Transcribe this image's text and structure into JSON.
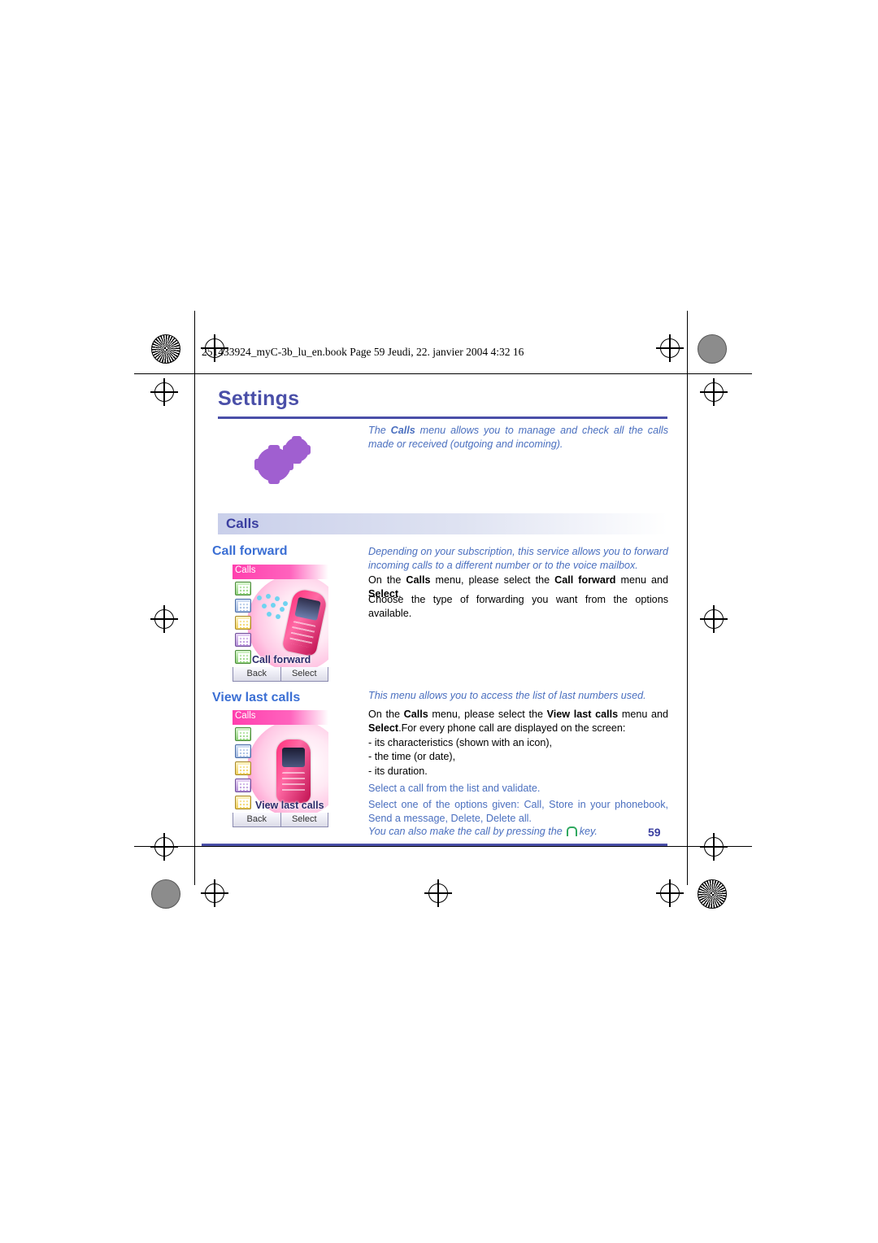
{
  "header": {
    "fileline": "251433924_myC-3b_lu_en.book  Page 59  Jeudi, 22. janvier 2004  4:32 16"
  },
  "chapter": {
    "title": "Settings",
    "intro_1": "The ",
    "intro_bold": "Calls",
    "intro_2": " menu allows you to manage and check all the calls made or received (outgoing and incoming)."
  },
  "section": {
    "label": "Calls"
  },
  "call_forward": {
    "heading": "Call forward",
    "para_italic": "Depending on your subscription, this service allows you to forward incoming calls to a different number or to the voice mailbox.",
    "para_2_a": "On the ",
    "para_2_b": "Calls",
    "para_2_c": " menu, please select the ",
    "para_2_d": "Call forward",
    "para_2_e": " menu and ",
    "para_2_f": "Select",
    "para_2_g": ".",
    "para_3": "Choose the type of forwarding you want from the options available.",
    "screenshot": {
      "title": "Calls",
      "label": "Call forward",
      "softkey_left": "Back",
      "softkey_right": "Select"
    }
  },
  "view_last_calls": {
    "heading": "View last calls",
    "para_italic": "This menu allows you to access the list of last numbers used.",
    "para_2_a": "On the ",
    "para_2_b": "Calls",
    "para_2_c": " menu, please select the ",
    "para_2_d": "View last calls",
    "para_2_e": " menu and ",
    "para_2_f": "Select",
    "para_2_g": ".",
    "para_3": "For every phone call are displayed on the screen:",
    "bullets": [
      "-  its characteristics (shown with an icon),",
      "-  the time (or date),",
      "-  its duration."
    ],
    "para_4": "Select a call from the list and validate.",
    "para_5": "Select one of the options given: Call, Store in your phonebook, Send a message, Delete, Delete all.",
    "para_6_a": "You can also make the call by pressing the ",
    "para_6_b": " key.",
    "screenshot": {
      "title": "Calls",
      "label": "View last calls",
      "softkey_left": "Back",
      "softkey_right": "Select"
    }
  },
  "footer": {
    "page_number": "59"
  },
  "colors": {
    "heading_blue": "#3b6fd4",
    "title_purple": "#4a4fa8",
    "italic_blue": "#4a6fbf",
    "pink": "#ff3fae"
  }
}
